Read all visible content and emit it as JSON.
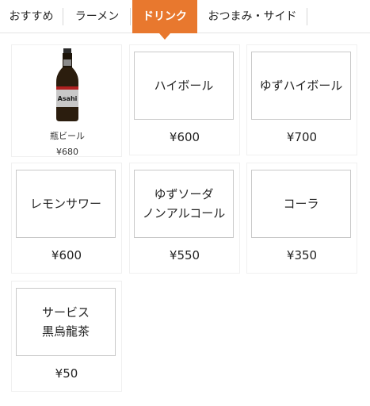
{
  "tabs": [
    {
      "label": "おすすめ"
    },
    {
      "label": "ラーメン"
    },
    {
      "label": "ドリンク"
    },
    {
      "label": "おつまみ・サイド"
    }
  ],
  "active_tab": "ドリンク",
  "accent_color": "#e8782e",
  "items": [
    {
      "name": "瓶ビール",
      "price": "¥680",
      "image": "asahi-beer-bottle"
    },
    {
      "name": "ハイボール",
      "price": "¥600"
    },
    {
      "name": "ゆずハイボール",
      "price": "¥700"
    },
    {
      "name_line1": "レモンサワー",
      "price": "¥600"
    },
    {
      "name_line1": "ゆずソーダ",
      "name_line2": "ノンアルコール",
      "price": "¥550"
    },
    {
      "name_line1": "コーラ",
      "price": "¥350"
    },
    {
      "name_line1": "サービス",
      "name_line2": "黒烏龍茶",
      "price": "¥50"
    }
  ],
  "bottle_label_text": "Asahi"
}
